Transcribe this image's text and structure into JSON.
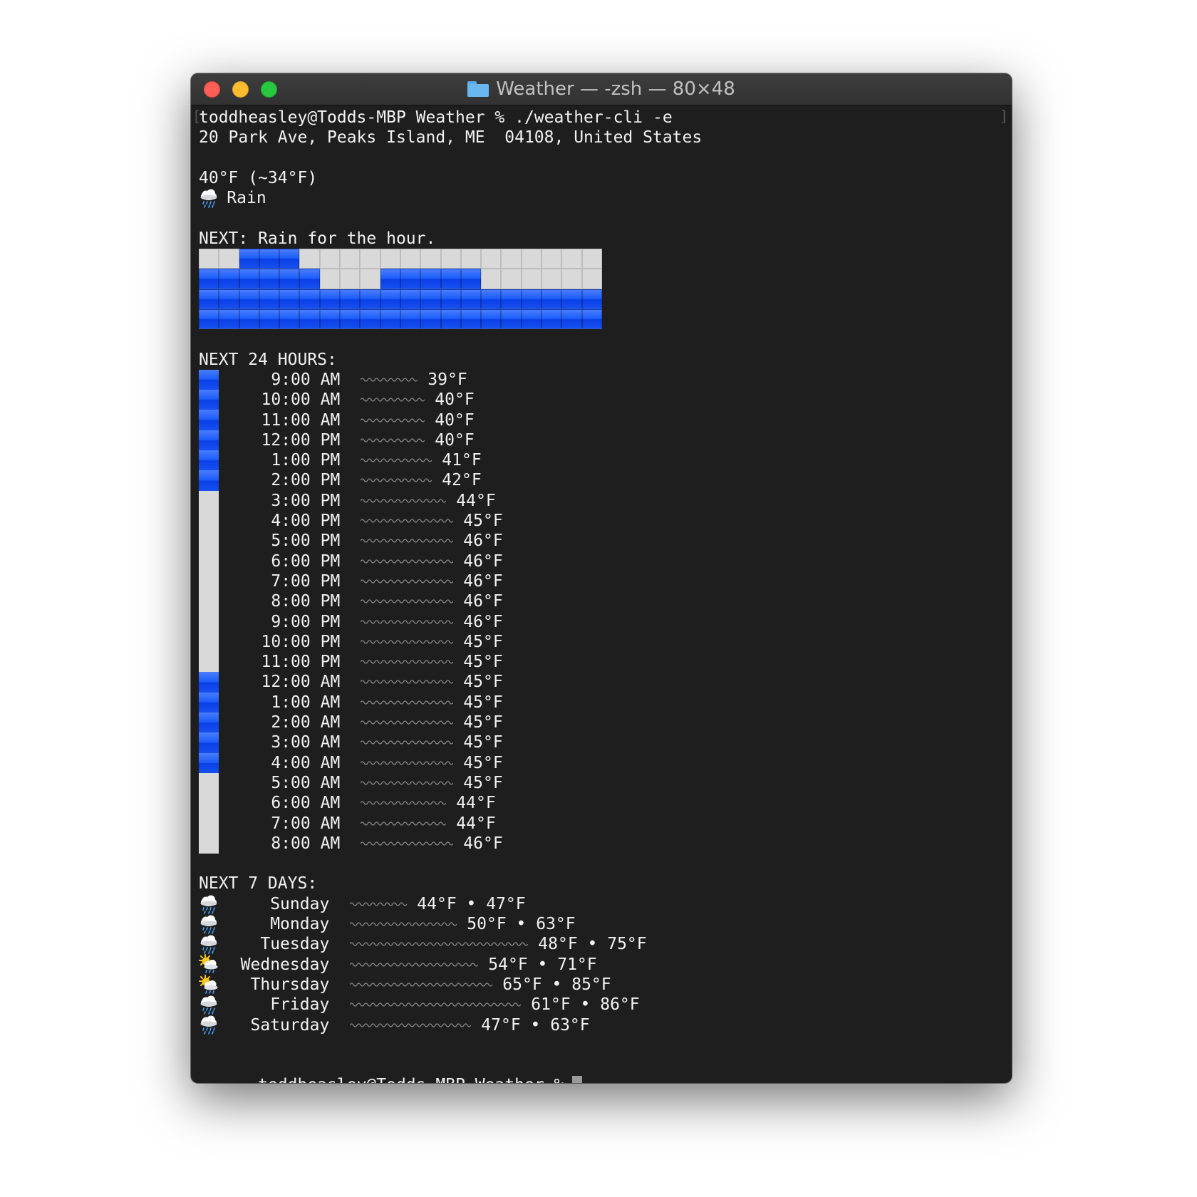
{
  "window": {
    "title": "Weather — -zsh — 80×48"
  },
  "terminal": {
    "command_line": "toddheasley@Todds-MBP Weather % ./weather-cli -e",
    "location": "20 Park Ave, Peaks Island, ME  04108, United States",
    "current_temp": "40°F (~34°F)",
    "current_condition": "Rain",
    "current_condition_icon": "rain-cloud-icon",
    "next_hour_label": "NEXT: Rain for the hour.",
    "minute_rows": [
      [
        "dry",
        "dry",
        "rain",
        "rain",
        "rain",
        "dry",
        "dry",
        "dry",
        "dry",
        "dry",
        "dry",
        "dry",
        "dry",
        "dry",
        "dry",
        "dry",
        "dry",
        "dry",
        "dry",
        "dry"
      ],
      [
        "rain",
        "rain",
        "rain",
        "rain",
        "rain",
        "rain",
        "dry",
        "dry",
        "dry",
        "rain",
        "rain",
        "rain",
        "rain",
        "rain",
        "dry",
        "dry",
        "dry",
        "dry",
        "dry",
        "dry"
      ],
      [
        "rain",
        "rain",
        "rain",
        "rain",
        "rain",
        "rain",
        "rain",
        "rain",
        "rain",
        "rain",
        "rain",
        "rain",
        "rain",
        "rain",
        "rain",
        "rain",
        "rain",
        "rain",
        "rain",
        "rain"
      ],
      [
        "rain",
        "rain",
        "rain",
        "rain",
        "rain",
        "rain",
        "rain",
        "rain",
        "rain",
        "rain",
        "rain",
        "rain",
        "rain",
        "rain",
        "rain",
        "rain",
        "rain",
        "rain",
        "rain",
        "rain"
      ]
    ],
    "hours_label": "NEXT 24 HOURS:",
    "hours": [
      {
        "time": "9:00 AM",
        "temp": "39°F",
        "precip": "rain"
      },
      {
        "time": "10:00 AM",
        "temp": "40°F",
        "precip": "rain"
      },
      {
        "time": "11:00 AM",
        "temp": "40°F",
        "precip": "rain"
      },
      {
        "time": "12:00 PM",
        "temp": "40°F",
        "precip": "rain"
      },
      {
        "time": "1:00 PM",
        "temp": "41°F",
        "precip": "rain"
      },
      {
        "time": "2:00 PM",
        "temp": "42°F",
        "precip": "rain"
      },
      {
        "time": "3:00 PM",
        "temp": "44°F",
        "precip": "dry"
      },
      {
        "time": "4:00 PM",
        "temp": "45°F",
        "precip": "dry"
      },
      {
        "time": "5:00 PM",
        "temp": "46°F",
        "precip": "dry"
      },
      {
        "time": "6:00 PM",
        "temp": "46°F",
        "precip": "dry"
      },
      {
        "time": "7:00 PM",
        "temp": "46°F",
        "precip": "dry"
      },
      {
        "time": "8:00 PM",
        "temp": "46°F",
        "precip": "dry"
      },
      {
        "time": "9:00 PM",
        "temp": "46°F",
        "precip": "dry"
      },
      {
        "time": "10:00 PM",
        "temp": "45°F",
        "precip": "dry"
      },
      {
        "time": "11:00 PM",
        "temp": "45°F",
        "precip": "dry"
      },
      {
        "time": "12:00 AM",
        "temp": "45°F",
        "precip": "rain"
      },
      {
        "time": "1:00 AM",
        "temp": "45°F",
        "precip": "rain"
      },
      {
        "time": "2:00 AM",
        "temp": "45°F",
        "precip": "rain"
      },
      {
        "time": "3:00 AM",
        "temp": "45°F",
        "precip": "rain"
      },
      {
        "time": "4:00 AM",
        "temp": "45°F",
        "precip": "rain"
      },
      {
        "time": "5:00 AM",
        "temp": "45°F",
        "precip": "dry"
      },
      {
        "time": "6:00 AM",
        "temp": "44°F",
        "precip": "dry"
      },
      {
        "time": "7:00 AM",
        "temp": "44°F",
        "precip": "dry"
      },
      {
        "time": "8:00 AM",
        "temp": "46°F",
        "precip": "dry"
      }
    ],
    "days_label": "NEXT 7 DAYS:",
    "days": [
      {
        "icon": "rain-cloud-icon",
        "name": "Sunday",
        "range": "44°F • 47°F",
        "low": 44,
        "high": 47
      },
      {
        "icon": "rain-cloud-icon",
        "name": "Monday",
        "range": "50°F • 63°F",
        "low": 50,
        "high": 63
      },
      {
        "icon": "rain-cloud-icon",
        "name": "Tuesday",
        "range": "48°F • 75°F",
        "low": 48,
        "high": 75
      },
      {
        "icon": "sun-behind-rain-cloud-icon",
        "name": "Wednesday",
        "range": "54°F • 71°F",
        "low": 54,
        "high": 71
      },
      {
        "icon": "sun-behind-rain-cloud-icon",
        "name": "Thursday",
        "range": "65°F • 85°F",
        "low": 65,
        "high": 85
      },
      {
        "icon": "rain-cloud-icon",
        "name": "Friday",
        "range": "61°F • 86°F",
        "low": 61,
        "high": 86
      },
      {
        "icon": "rain-cloud-icon",
        "name": "Saturday",
        "range": "47°F • 63°F",
        "low": 47,
        "high": 63
      }
    ],
    "prompt": "toddheasley@Todds-MBP Weather %"
  },
  "colors": {
    "rain": "#1a5cf8",
    "dry": "#d9d9d9",
    "background": "#1e1e1e"
  }
}
